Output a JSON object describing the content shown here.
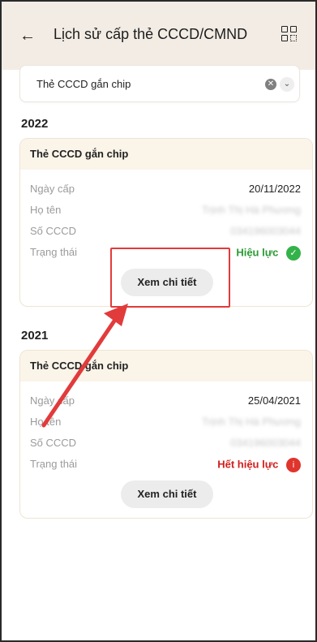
{
  "header": {
    "title": "Lịch sử cấp thẻ CCCD/CMND",
    "back_icon": "arrow-left-icon",
    "qr_icon": "qr-code-icon"
  },
  "filter": {
    "selected": "Thẻ CCCD gắn chip"
  },
  "records": [
    {
      "year": "2022",
      "card_type": "Thẻ CCCD gắn chip",
      "rows": [
        {
          "label": "Ngày cấp",
          "value": "20/11/2022"
        },
        {
          "label": "Họ tên",
          "value": "Trịnh Thị Hà Phương"
        },
        {
          "label": "Số CCCD",
          "value": "034196003044"
        },
        {
          "label": "Trạng thái",
          "value": "Hiệu lực"
        }
      ],
      "status_color": "#2a9a33",
      "detail_label": "Xem chi tiết"
    },
    {
      "year": "2021",
      "card_type": "Thẻ CCCD gắn chip",
      "rows": [
        {
          "label": "Ngày cấp",
          "value": "25/04/2021"
        },
        {
          "label": "Họ tên",
          "value": "Trịnh Thị Hà Phương"
        },
        {
          "label": "Số CCCD",
          "value": "034196003044"
        },
        {
          "label": "Trạng thái",
          "value": "Hết hiệu lực"
        }
      ],
      "status_color": "#d0201d",
      "detail_label": "Xem chi tiết"
    }
  ]
}
